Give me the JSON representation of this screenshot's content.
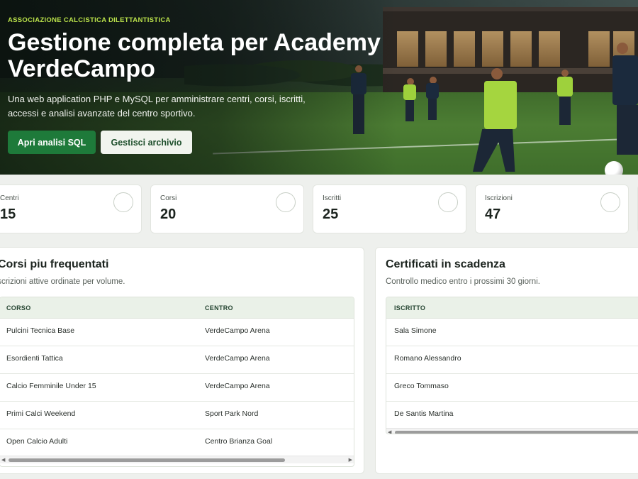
{
  "hero": {
    "eyebrow": "ASSOCIAZIONE CALCISTICA DILETTANTISTICA",
    "title": "Gestione completa per Academy VerdeCampo",
    "description": "Una web application PHP e MySQL per amministrare centri, corsi, iscritti, accessi e analisi avanzate del centro sportivo.",
    "primary_button": "Apri analisi SQL",
    "secondary_button": "Gestisci archivio"
  },
  "stats": [
    {
      "label": "Centri",
      "value": "15"
    },
    {
      "label": "Corsi",
      "value": "20"
    },
    {
      "label": "Iscritti",
      "value": "25"
    },
    {
      "label": "Iscrizioni",
      "value": "47"
    }
  ],
  "courses_panel": {
    "title": "Corsi piu frequentati",
    "subtitle": "Iscrizioni attive ordinate per volume.",
    "columns": [
      "CORSO",
      "CENTRO"
    ],
    "rows": [
      [
        "Pulcini Tecnica Base",
        "VerdeCampo Arena"
      ],
      [
        "Esordienti Tattica",
        "VerdeCampo Arena"
      ],
      [
        "Calcio Femminile Under 15",
        "VerdeCampo Arena"
      ],
      [
        "Primi Calci Weekend",
        "Sport Park Nord"
      ],
      [
        "Open Calcio Adulti",
        "Centro Brianza Goal"
      ]
    ]
  },
  "certs_panel": {
    "title": "Certificati in scadenza",
    "subtitle": "Controllo medico entro i prossimi 30 giorni.",
    "columns": [
      "ISCRITTO"
    ],
    "rows": [
      [
        "Sala Simone"
      ],
      [
        "Romano Alessandro"
      ],
      [
        "Greco Tommaso"
      ],
      [
        "De Santis Martina"
      ]
    ]
  },
  "colors": {
    "accent": "#1e7a3a",
    "eyebrow": "#b9e04a",
    "table_header": "#eaf1e8"
  }
}
